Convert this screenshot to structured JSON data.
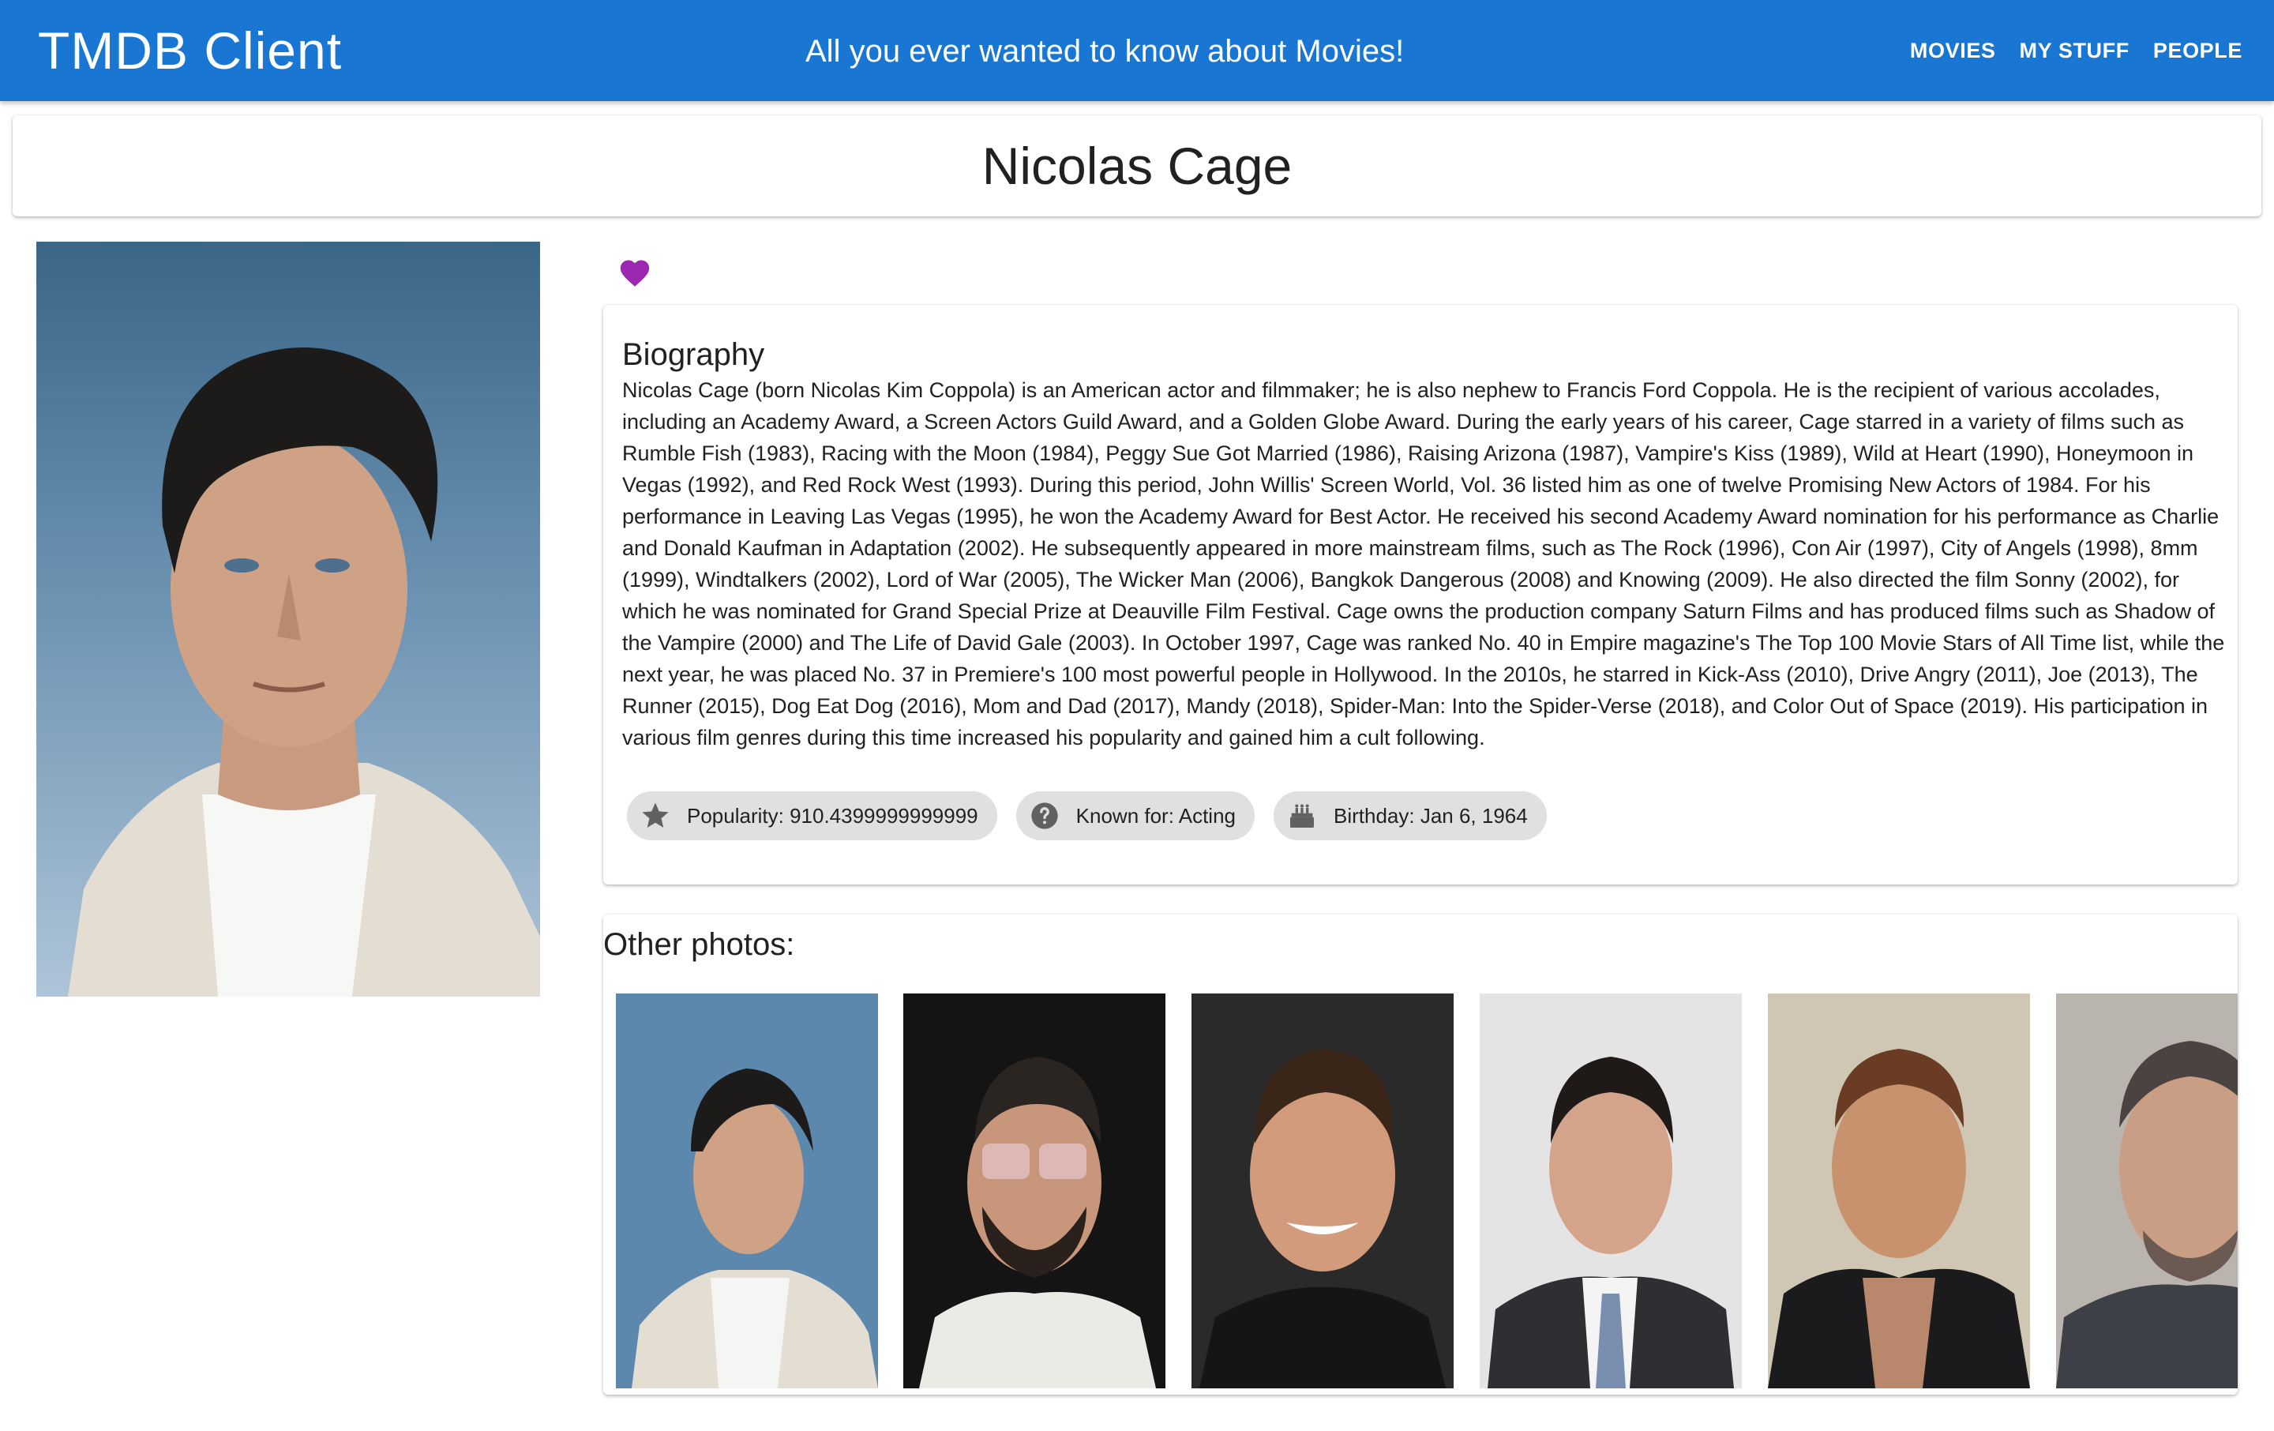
{
  "app": {
    "brand": "TMDB Client",
    "tagline": "All you ever wanted to know about Movies!",
    "nav": [
      "MOVIES",
      "MY STUFF",
      "PEOPLE"
    ]
  },
  "person": {
    "name": "Nicolas Cage",
    "favorite_icon": "heart-icon",
    "favorite_color": "#9c27b0"
  },
  "biography": {
    "heading": "Biography",
    "text": "Nicolas Cage (born Nicolas Kim Coppola) is an American actor and filmmaker; he is also nephew to Francis Ford Coppola. He is the recipient of various accolades, including an Academy Award, a Screen Actors Guild Award, and a Golden Globe Award. During the early years of his career, Cage starred in a variety of films such as Rumble Fish (1983), Racing with the Moon (1984), Peggy Sue Got Married (1986), Raising Arizona (1987), Vampire's Kiss (1989), Wild at Heart (1990), Honeymoon in Vegas (1992), and Red Rock West (1993). During this period, John Willis' Screen World, Vol. 36 listed him as one of twelve Promising New Actors of 1984. For his performance in Leaving Las Vegas (1995), he won the Academy Award for Best Actor. He received his second Academy Award nomination for his performance as Charlie and Donald Kaufman in Adaptation (2002). He subsequently appeared in more mainstream films, such as The Rock (1996), Con Air (1997), City of Angels (1998), 8mm (1999), Windtalkers (2002), Lord of War (2005), The Wicker Man (2006), Bangkok Dangerous (2008) and Knowing (2009). He also directed the film Sonny (2002), for which he was nominated for Grand Special Prize at Deauville Film Festival. Cage owns the production company Saturn Films and has produced films such as Shadow of the Vampire (2000) and The Life of David Gale (2003). In October 1997, Cage was ranked No. 40 in Empire magazine's The Top 100 Movie Stars of All Time list, while the next year, he was placed No. 37 in Premiere's 100 most powerful people in Hollywood. In the 2010s, he starred in Kick-Ass (2010), Drive Angry (2011), Joe (2013), The Runner (2015), Dog Eat Dog (2016), Mom and Dad (2017), Mandy (2018), Spider-Man: Into the Spider-Verse (2018), and Color Out of Space (2019). His participation in various film genres during this time increased his popularity and gained him a cult following."
  },
  "chips": [
    {
      "icon": "star-icon",
      "label": "Popularity: 910.4399999999999"
    },
    {
      "icon": "question-icon",
      "label": "Known for: Acting"
    },
    {
      "icon": "cake-icon",
      "label": "Birthday: Jan 6, 1964"
    }
  ],
  "photos": {
    "heading": "Other photos:",
    "backgrounds": [
      "#5d88ad",
      "#141414",
      "#2a2a2a",
      "#e4e4e4",
      "#cfc7b3",
      "#b9b4ad"
    ]
  },
  "colors": {
    "appbar": "#1976d2",
    "chip_bg": "#e0e0e0"
  }
}
